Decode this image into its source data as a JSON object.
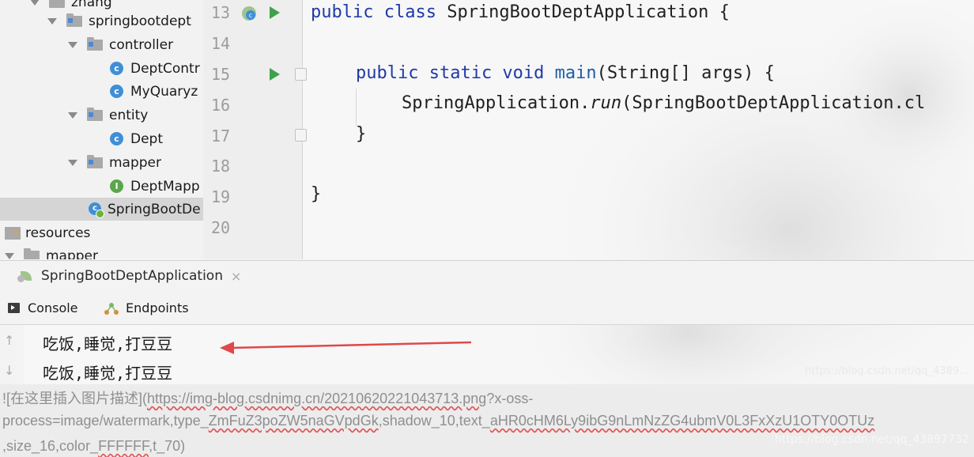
{
  "project_tree": {
    "items": [
      {
        "label": "zhang",
        "icon": "folder-icon",
        "expanded": true
      },
      {
        "label": "springbootdept",
        "icon": "package-icon",
        "expanded": true
      },
      {
        "label": "controller",
        "icon": "package-icon",
        "expanded": true
      },
      {
        "label": "DeptContr",
        "icon": "class-icon"
      },
      {
        "label": "MyQuaryz",
        "icon": "class-icon"
      },
      {
        "label": "entity",
        "icon": "package-icon",
        "expanded": true
      },
      {
        "label": "Dept",
        "icon": "class-icon"
      },
      {
        "label": "mapper",
        "icon": "package-icon",
        "expanded": true
      },
      {
        "label": "DeptMapp",
        "icon": "interface-icon"
      },
      {
        "label": "SpringBootDe",
        "icon": "spring-boot-class-icon",
        "selected": true
      },
      {
        "label": "resources",
        "icon": "resources-folder-icon"
      },
      {
        "label": "mapper",
        "icon": "folder-icon",
        "expanded": true
      }
    ]
  },
  "editor": {
    "line_numbers": [
      "13",
      "14",
      "15",
      "16",
      "17",
      "18",
      "19",
      "20"
    ],
    "lines": {
      "l13_kw": "public class",
      "l13_rest": " SpringBootDeptApplication {",
      "l15_kw": "public static void",
      "l15_fn": " main",
      "l15_rest": "(String[] args) {",
      "l16_pre": "SpringApplication.",
      "l16_it": "run",
      "l16_rest": "(SpringBootDeptApplication.cl",
      "l17": "}",
      "l19": "}"
    }
  },
  "run_panel": {
    "run_tab": "SpringBootDeptApplication",
    "close_glyph": "×",
    "tabs": [
      "Console",
      "Endpoints"
    ],
    "output_lines": [
      "吃饭,睡觉,打豆豆",
      "吃饭,睡觉,打豆豆"
    ],
    "scroll_up": "↑",
    "scroll_down": "↓"
  },
  "watermarks": {
    "upper": "https://blog.csdn.net/qq_4389...",
    "lower": "https://blog.csdn.net/qq_43897732"
  },
  "markdown_text": {
    "line1_a": "![在这里插入图片描述](",
    "line1_b": "https://img-blog.csdnimg.cn/20210620221043713.png",
    "line1_c": "?x-oss-",
    "line2_a": "process=image/watermark,type_",
    "line2_b": "ZmFuZ3poZW5naGVpdGk",
    "line2_c": ",shadow_10,text_",
    "line2_d": "aHR0cHM6Ly9ibG9nLmNzZG4ubmV0L3FxXzU1OTY0OTUz",
    "line3_a": ",size_16,color_",
    "line3_b": "FFFFFF",
    "line3_c": ",t_70)"
  },
  "colors": {
    "keyword": "#1f3aa6",
    "run_green": "#3fa14c",
    "annotation_arrow": "#e0484a"
  }
}
